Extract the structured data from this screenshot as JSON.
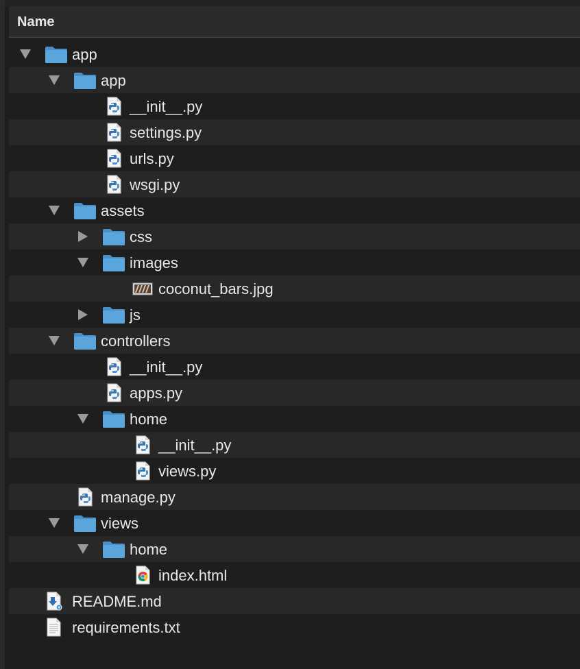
{
  "header": {
    "name_column": "Name"
  },
  "colors": {
    "background": "#1e1e1e",
    "row_alt": "#282828",
    "folder": "#5aa6dc",
    "text": "#e8e8e8"
  },
  "tree": [
    {
      "label": "app",
      "kind": "folder",
      "depth": 0,
      "expanded": true
    },
    {
      "label": "app",
      "kind": "folder",
      "depth": 1,
      "expanded": true
    },
    {
      "label": "__init__.py",
      "kind": "python",
      "depth": 2
    },
    {
      "label": "settings.py",
      "kind": "python",
      "depth": 2
    },
    {
      "label": "urls.py",
      "kind": "python",
      "depth": 2
    },
    {
      "label": "wsgi.py",
      "kind": "python",
      "depth": 2
    },
    {
      "label": "assets",
      "kind": "folder",
      "depth": 1,
      "expanded": true
    },
    {
      "label": "css",
      "kind": "folder",
      "depth": 2,
      "expanded": false
    },
    {
      "label": "images",
      "kind": "folder",
      "depth": 2,
      "expanded": true
    },
    {
      "label": "coconut_bars.jpg",
      "kind": "image",
      "depth": 3
    },
    {
      "label": "js",
      "kind": "folder",
      "depth": 2,
      "expanded": false
    },
    {
      "label": "controllers",
      "kind": "folder",
      "depth": 1,
      "expanded": true
    },
    {
      "label": "__init__.py",
      "kind": "python",
      "depth": 2
    },
    {
      "label": "apps.py",
      "kind": "python",
      "depth": 2
    },
    {
      "label": "home",
      "kind": "folder",
      "depth": 2,
      "expanded": true
    },
    {
      "label": "__init__.py",
      "kind": "python",
      "depth": 3
    },
    {
      "label": "views.py",
      "kind": "python",
      "depth": 3
    },
    {
      "label": "manage.py",
      "kind": "python",
      "depth": 1
    },
    {
      "label": "views",
      "kind": "folder",
      "depth": 1,
      "expanded": true
    },
    {
      "label": "home",
      "kind": "folder",
      "depth": 2,
      "expanded": true
    },
    {
      "label": "index.html",
      "kind": "html",
      "depth": 3
    },
    {
      "label": "README.md",
      "kind": "markdown",
      "depth": 0
    },
    {
      "label": "requirements.txt",
      "kind": "text",
      "depth": 0
    }
  ]
}
